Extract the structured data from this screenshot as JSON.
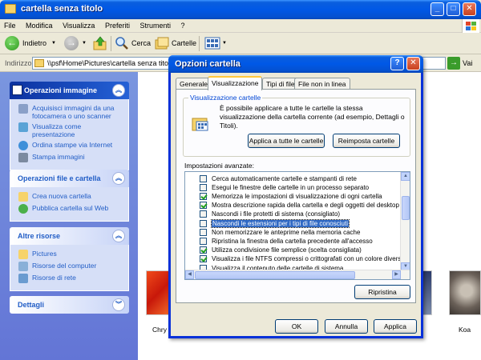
{
  "window": {
    "title": "cartella senza titolo",
    "minimize": "_",
    "maximize": "□",
    "close": "✕"
  },
  "menu": [
    "File",
    "Modifica",
    "Visualizza",
    "Preferiti",
    "Strumenti",
    "?"
  ],
  "toolbar": {
    "back": "Indietro",
    "search": "Cerca",
    "folders": "Cartelle"
  },
  "address": {
    "label": "Indirizzo",
    "value": "\\\\psf\\Home\\Pictures\\cartella senza titolo",
    "go": "Vai"
  },
  "tasks": {
    "image": {
      "title": "Operazioni immagine",
      "items": [
        "Acquisisci immagini da una fotocamera o uno scanner",
        "Visualizza come presentazione",
        "Ordina stampe via Internet",
        "Stampa immagini"
      ]
    },
    "files": {
      "title": "Operazioni file e cartella",
      "items": [
        "Crea nuova cartella",
        "Pubblica cartella sul Web"
      ]
    },
    "other": {
      "title": "Altre risorse",
      "items": [
        "Pictures",
        "Risorse del computer",
        "Risorse di rete"
      ]
    },
    "details": {
      "title": "Dettagli"
    }
  },
  "content": {
    "thumb1_label": "Chry",
    "thumb3_label": "Koa"
  },
  "dialog": {
    "title": "Opzioni cartella",
    "help": "?",
    "close": "✕",
    "tabs": [
      "Generale",
      "Visualizzazione",
      "Tipi di file",
      "File non in linea"
    ],
    "group_title": "Visualizzazione cartelle",
    "group_text": "È possibile applicare a tutte le cartelle la stessa visualizzazione della cartella corrente (ad esempio, Dettagli o Titoli).",
    "apply_all": "Applica a tutte le cartelle",
    "reset_all": "Reimposta cartelle",
    "advanced_label": "Impostazioni avanzate:",
    "settings": [
      {
        "text": "Cerca automaticamente cartelle e stampanti di rete",
        "checked": false
      },
      {
        "text": "Esegui le finestre delle cartelle in un processo separato",
        "checked": false
      },
      {
        "text": "Memorizza le impostazioni di visualizzazione di ogni cartella",
        "checked": true
      },
      {
        "text": "Mostra descrizione rapida della cartella e degli oggetti del desktop",
        "checked": true
      },
      {
        "text": "Nascondi i file protetti di sistema (consigliato)",
        "checked": false
      },
      {
        "text": "Nascondi le estensioni per i tipi di file conosciuti",
        "checked": false,
        "selected": true
      },
      {
        "text": "Non memorizzare le anteprime nella memoria cache",
        "checked": false
      },
      {
        "text": "Ripristina la finestra della cartella precedente all'accesso",
        "checked": false
      },
      {
        "text": "Utilizza condivisione file semplice (scelta consigliata)",
        "checked": true
      },
      {
        "text": "Visualizza i file NTFS compressi o crittografati con un colore diverso",
        "checked": true
      },
      {
        "text": "Visualizza il contenuto delle cartelle di sistema",
        "checked": false
      }
    ],
    "restore": "Ripristina",
    "ok": "OK",
    "cancel": "Annulla",
    "apply": "Applica"
  },
  "colors": {
    "xp_blue": "#0058e6",
    "task_pane": "#6375d6",
    "selection": "#316ac5"
  }
}
